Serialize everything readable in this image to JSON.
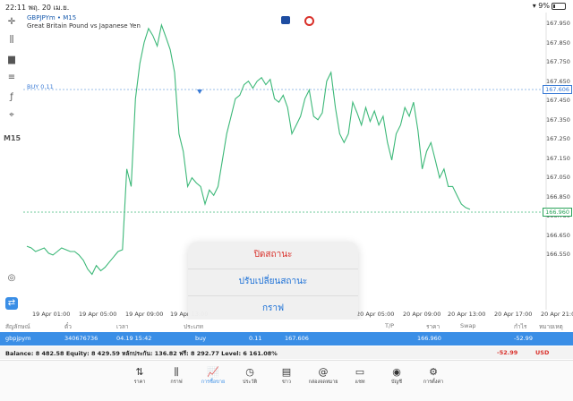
{
  "status": {
    "time": "22:11",
    "date": "พฤ. 20 เม.ย.",
    "battery": "9%"
  },
  "symbol": {
    "title": "GBPJPYm • M15",
    "description": "Great Britain Pound vs Japanese Yen"
  },
  "left_tools": [
    "crosshair",
    "candles",
    "bars",
    "line",
    "function",
    "shapes"
  ],
  "timeframe": "M15",
  "yaxis": [
    "167.950",
    "167.850",
    "167.750",
    "167.650",
    "167.450",
    "167.350",
    "167.250",
    "167.150",
    "167.050",
    "166.850",
    "166.750",
    "166.650",
    "166.550"
  ],
  "buy_line": {
    "label": "BUY 0.11",
    "price": "167.606"
  },
  "current_price": "166.960",
  "xaxis": [
    "19 Apr 01:00",
    "19 Apr 05:00",
    "19 Apr 09:00",
    "19 Apr 13:00",
    "20 Apr 05:00",
    "20 Apr 09:00",
    "20 Apr 13:00",
    "20 Apr 17:00",
    "20 Apr 21:00"
  ],
  "popup": {
    "close": "ปิดสถานะ",
    "modify": "ปรับเปลี่ยนสถานะ",
    "chart": "กราฟ"
  },
  "table_header": {
    "symbol": "สัญลักษณ์",
    "ticket": "ตั๋ว",
    "time": "เวลา",
    "type": "ประเภท",
    "volume": "",
    "price": "",
    "sl": "",
    "tp": "T/P",
    "current": "ราคา",
    "swap": "Swap",
    "profit": "กำไร",
    "comment": "หมายเหตุ"
  },
  "position": {
    "symbol": "gbpjpym",
    "ticket": "340676736",
    "time": "04.19 15:42",
    "type": "buy",
    "volume": "0.11",
    "price": "167.606",
    "current": "166.960",
    "profit": "-52.99"
  },
  "balance": {
    "text": "Balance: 8 482.58 Equity: 8 429.59 หลักประกัน: 136.82 ฟรี: 8 292.77 Level: 6 161.08%",
    "pl": "-52.99",
    "currency": "USD"
  },
  "nav": [
    "ราคา",
    "กราฟ",
    "การซื้อขาย",
    "ประวัติ",
    "ข่าว",
    "กล่องจดหมาย",
    "แชท",
    "บัญชี",
    "การตั้งค่า"
  ],
  "colors": {
    "accent": "#3a8ee6",
    "line": "#3cb878",
    "loss": "#d9302a"
  },
  "chart_data": {
    "type": "line",
    "series": [
      {
        "values": [
          166.76,
          166.75,
          166.73,
          166.74,
          166.75,
          166.72,
          166.71,
          166.73,
          166.75,
          166.74,
          166.73,
          166.73,
          166.71,
          166.68,
          166.63,
          166.6,
          166.65,
          166.62,
          166.64,
          166.67,
          166.7,
          166.73,
          166.74,
          167.2,
          167.1,
          167.6,
          167.8,
          167.92,
          168.0,
          167.96,
          167.9,
          168.02,
          167.95,
          167.88,
          167.75,
          167.4,
          167.3,
          167.1,
          167.15,
          167.12,
          167.1,
          167.0,
          167.08,
          167.05,
          167.1,
          167.25,
          167.4,
          167.5,
          167.6,
          167.62,
          167.68,
          167.7,
          167.66,
          167.7,
          167.72,
          167.68,
          167.71,
          167.6,
          167.58,
          167.62,
          167.55,
          167.4,
          167.45,
          167.5,
          167.6,
          167.65,
          167.5,
          167.48,
          167.52,
          167.7,
          167.75,
          167.55,
          167.4,
          167.35,
          167.4,
          167.58,
          167.52,
          167.45,
          167.55,
          167.47,
          167.53,
          167.45,
          167.5,
          167.35,
          167.25,
          167.4,
          167.45,
          167.55,
          167.5,
          167.58,
          167.42,
          167.2,
          167.3,
          167.35,
          167.25,
          167.15,
          167.2,
          167.1,
          167.1,
          167.05,
          167.0,
          166.98,
          166.97
        ]
      }
    ],
    "ylim": [
      166.48,
      168.05
    ],
    "grid": false
  }
}
